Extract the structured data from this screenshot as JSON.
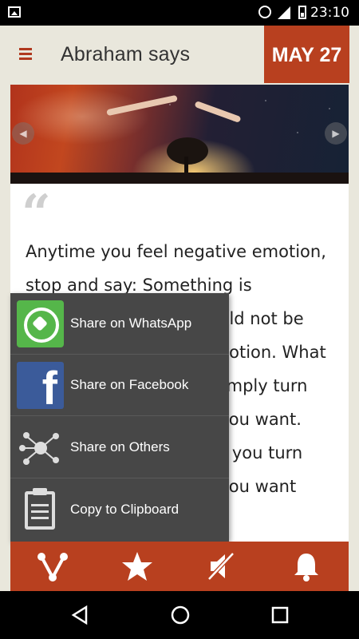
{
  "status_bar": {
    "time": "23:10"
  },
  "app_bar": {
    "title": "Abraham says",
    "date": "MAY 27"
  },
  "quote": {
    "mark": "“",
    "text": "Anytime you feel negative emotion, stop and say: Something is important here, or I would not be feeling this negative emotion. What is it that I want? Then simply turn your attention to what you want. And in the moment that you turn your attention to what you want"
  },
  "share_menu": {
    "items": [
      {
        "label": "Share on WhatsApp",
        "icon": "whatsapp-icon"
      },
      {
        "label": "Share on Facebook",
        "icon": "facebook-icon"
      },
      {
        "label": "Share on Others",
        "icon": "share-nodes-icon"
      },
      {
        "label": "Copy to Clipboard",
        "icon": "clipboard-icon"
      }
    ]
  },
  "bottom_bar": {
    "icons": [
      "share-icon",
      "star-icon",
      "mute-icon",
      "bell-icon"
    ]
  },
  "colors": {
    "accent": "#b8401f",
    "menu_bg": "#474747",
    "page_bg": "#e9e7dc",
    "whatsapp": "#55b64a",
    "facebook": "#3b5b9a"
  }
}
